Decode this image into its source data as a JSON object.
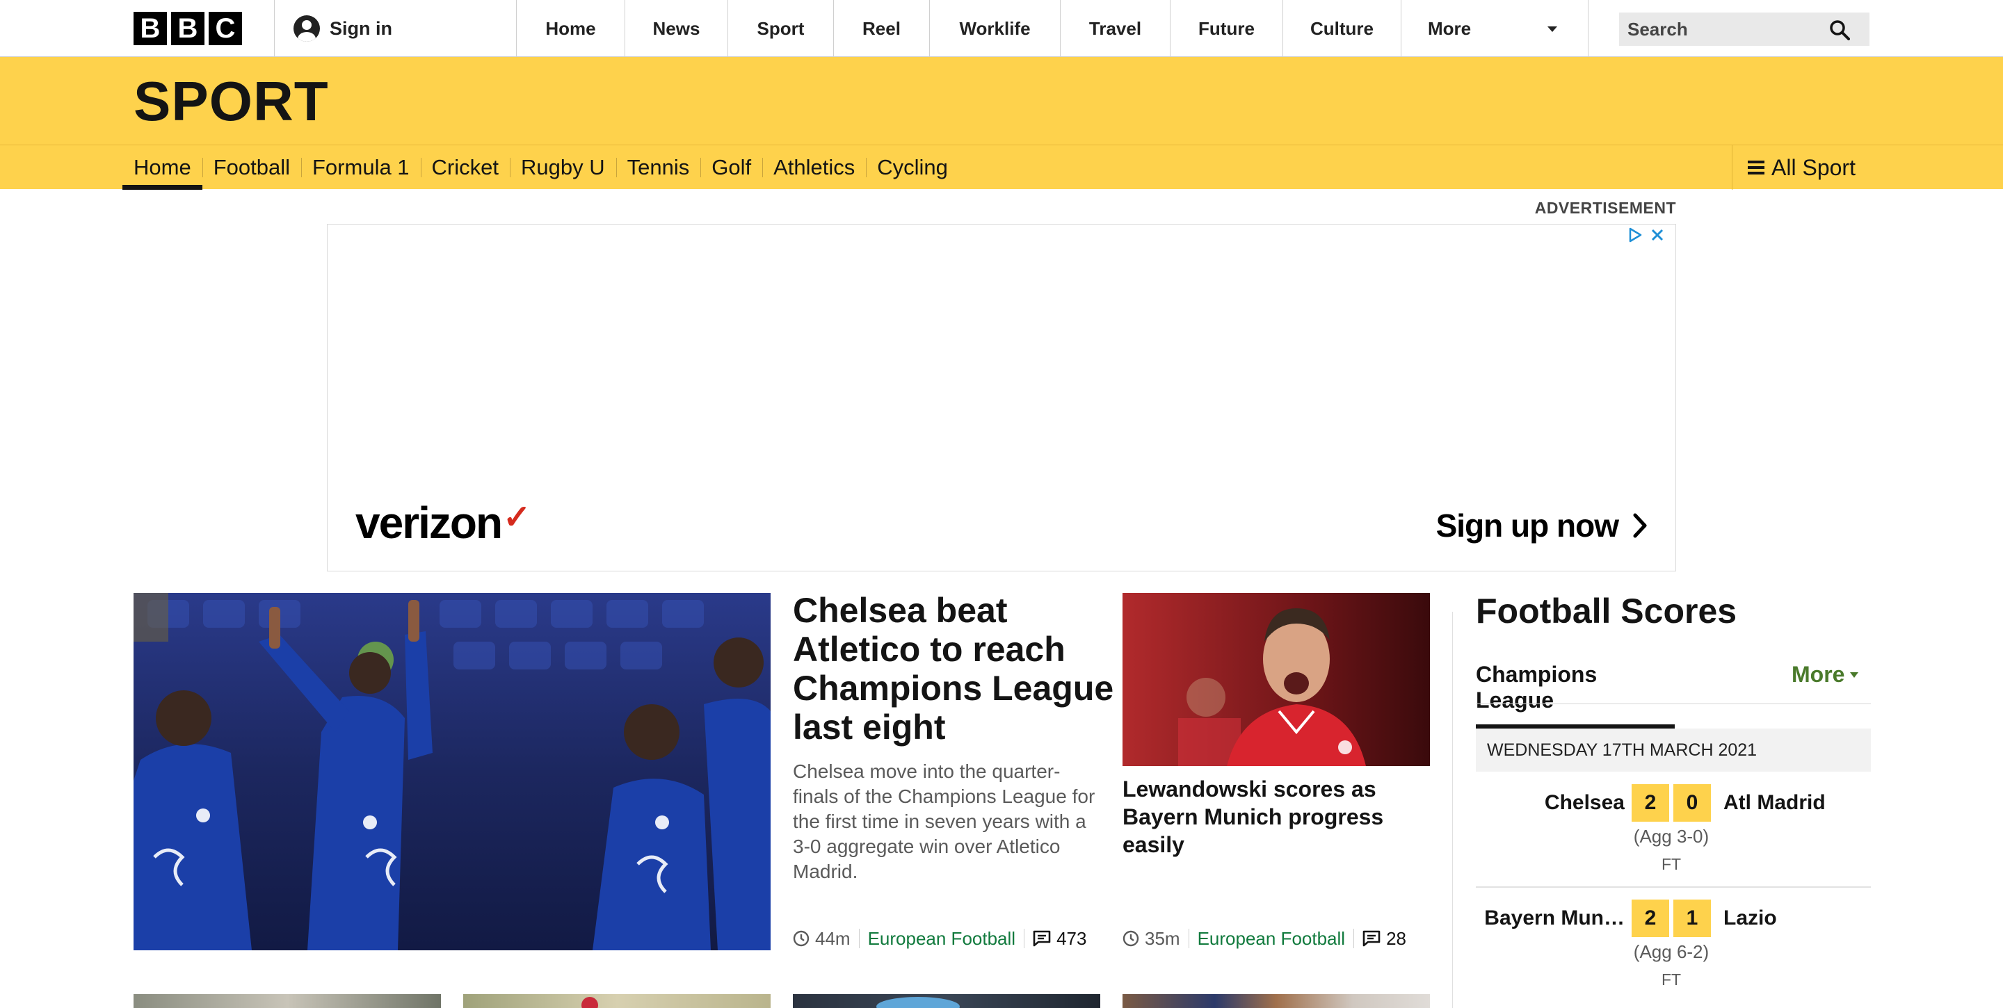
{
  "brand": {
    "letters": [
      "B",
      "B",
      "C"
    ]
  },
  "account": {
    "signin_label": "Sign in"
  },
  "topnav": {
    "items": [
      "Home",
      "News",
      "Sport",
      "Reel",
      "Worklife",
      "Travel",
      "Future",
      "Culture"
    ],
    "more_label": "More"
  },
  "search": {
    "placeholder": "Search"
  },
  "section": {
    "title": "SPORT"
  },
  "subnav": {
    "items": [
      "Home",
      "Football",
      "Formula 1",
      "Cricket",
      "Rugby U",
      "Tennis",
      "Golf",
      "Athletics",
      "Cycling"
    ],
    "active_index": 0,
    "all_sport_label": "All Sport"
  },
  "advert": {
    "label": "ADVERTISEMENT",
    "brand": "verizon",
    "brand_mark": "✓",
    "cta": "Sign up now"
  },
  "lead_story": {
    "headline": "Chelsea beat Atletico to reach Champions League last eight",
    "summary": "Chelsea move into the quarter-finals of the Champions League for the first time in seven years with a 3-0 aggregate win over Atletico Madrid.",
    "time": "44m",
    "tag": "European Football",
    "comments": "473"
  },
  "second_story": {
    "headline": "Lewandowski scores as Bayern Munich progress easily",
    "time": "35m",
    "tag": "European Football",
    "comments": "28"
  },
  "football_scores": {
    "title": "Football Scores",
    "tab": "Champions League",
    "more_label": "More",
    "date": "WEDNESDAY 17TH MARCH 2021",
    "fixtures": [
      {
        "home": "Chelsea",
        "home_score": "2",
        "away_score": "0",
        "away": "Atl Madrid",
        "aggregate": "(Agg 3-0)",
        "status": "FT"
      },
      {
        "home": "Bayern Mun…",
        "home_score": "2",
        "away_score": "1",
        "away": "Lazio",
        "aggregate": "(Agg 6-2)",
        "status": "FT"
      }
    ]
  },
  "colors": {
    "sport_yellow": "#fed24c",
    "tag_green": "#117a3d",
    "more_green": "#4a7a2b",
    "verizon_red": "#d52b1e"
  },
  "icons": [
    "avatar-icon",
    "search-icon",
    "caret-down-icon",
    "hamburger-icon",
    "ad-choices-icon",
    "close-icon",
    "chevron-right-icon",
    "clock-icon",
    "comments-icon"
  ]
}
